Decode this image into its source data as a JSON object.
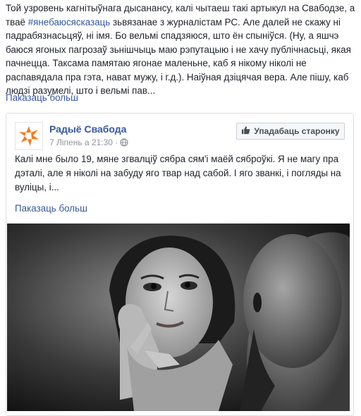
{
  "post": {
    "text_before": "Той узровень кагнітыўнага дысанансу, калі чытаеш такі артыкул на Свабодзе, а тваё ",
    "hashtag": "#янебаюсясказаць",
    "text_after": " зьвязанае з журналістам РС. Але далей не скажу ні падрабязнасьцяў, ні імя. Бо вельмі спадзяюся, што ён спыніўся. (Ну, а яшчэ баюся ягоных пагрозаў зьнішчыць маю рэпутацыю і не хачу публічнасьці, якая пачнецца. Таксама памятаю ягонае маленьне, каб я нікому ніколі не распавядала пра гэта, нават мужу, і г.д.). Наіўная дзіцячая вера. Але пішу, каб людзі разумелі, што і вельмі пав...",
    "see_more": "Паказаць больш"
  },
  "shared_post": {
    "page_name": "Радыё Свабода",
    "date": "7 Ліпень а 21:30 ·",
    "like_page_label": "Упадабаць старонку",
    "text": "Калі мне было 19, мяне згвалціў сябра сям'і маёй сяброўкі. Я не магу пра дэталі, але я ніколі на забуду яго твар над сабой. І яго званкі, і погляды на вуліцы, і...",
    "see_more": "Паказаць больш"
  },
  "colors": {
    "link": "#365899",
    "logo_orange": "#f47b20",
    "text": "#1d2129",
    "meta": "#90949c"
  },
  "icons": [
    "radio-svaboda-logo-icon",
    "globe-icon",
    "thumbs-up-icon"
  ]
}
